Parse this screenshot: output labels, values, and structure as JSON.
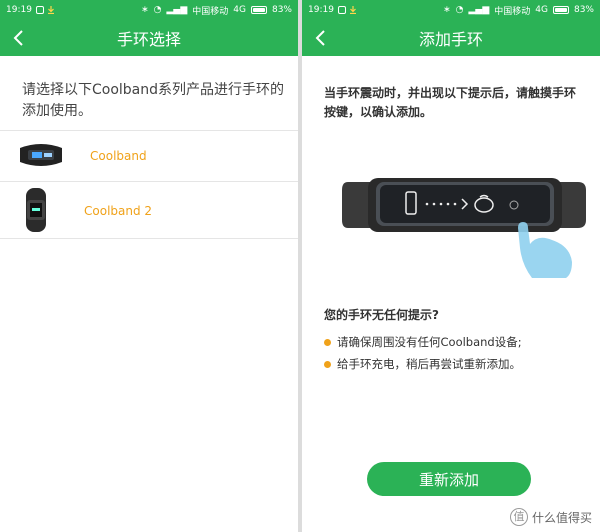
{
  "status_bar": {
    "time": "19:19",
    "carrier": "中国移动",
    "network": "4G",
    "battery": "83%",
    "battery_level": 0.83
  },
  "left_screen": {
    "title": "手环选择",
    "intro": "请选择以下Coolband系列产品进行手环的添加使用。",
    "products": [
      {
        "label": "Coolband",
        "image": "coolband-band-image"
      },
      {
        "label": "Coolband 2",
        "image": "coolband2-band-image"
      }
    ]
  },
  "right_screen": {
    "title": "添加手环",
    "instruction": "当手环震动时，并出现以下提示后，请触摸手环按键，以确认添加。",
    "no_prompt_title": "您的手环无任何提示?",
    "tips": [
      "请确保周围没有任何Coolband设备;",
      "给手环充电，稍后再尝试重新添加。"
    ],
    "button": "重新添加"
  },
  "watermark": {
    "text": "什么值得买",
    "badge": "值"
  },
  "colors": {
    "brand_green": "#2bb256",
    "accent_orange": "#f0a21a"
  }
}
